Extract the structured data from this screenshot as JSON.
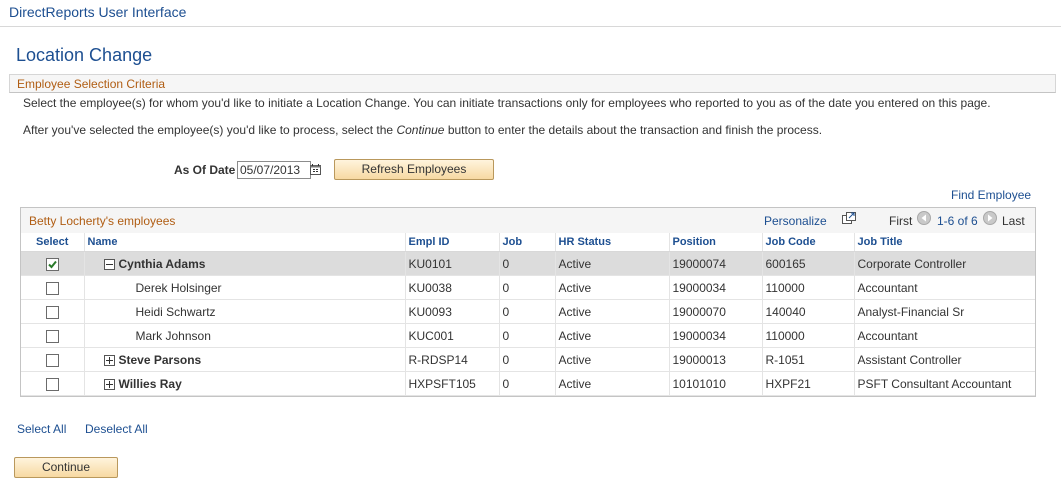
{
  "app": {
    "title": "DirectReports User Interface"
  },
  "page": {
    "title": "Location Change"
  },
  "section": {
    "title": "Employee Selection Criteria"
  },
  "instructions": {
    "line1": "Select the employee(s) for whom you'd like to initiate a Location Change. You can initiate transactions only for employees who reported to you as of the date you entered on this page.",
    "line2_before": "After you've selected the employee(s) you'd like to process, select the ",
    "line2_emph": "Continue",
    "line2_after": " button to enter the details about the transaction and finish the process."
  },
  "as_of": {
    "label": "As Of Date",
    "value": "05/07/2013",
    "icon": "calendar-icon"
  },
  "buttons": {
    "refresh": "Refresh Employees",
    "continue": "Continue"
  },
  "find_employee": "Find Employee",
  "grid": {
    "caption": "Betty Locherty's employees",
    "personalize": "Personalize",
    "zoom_icon": "zoom-icon",
    "nav": {
      "first": "First",
      "range": "1-6 of 6",
      "last": "Last"
    },
    "columns": [
      "Select",
      "Name",
      "Empl ID",
      "Job",
      "HR Status",
      "Position",
      "Job Code",
      "Job Title"
    ],
    "rows": [
      {
        "checked": true,
        "tree": "minus",
        "level": 1,
        "bold": true,
        "name": "Cynthia Adams",
        "empl_id": "KU0101",
        "job": "0",
        "hr_status": "Active",
        "position": "19000074",
        "job_code": "600165",
        "job_title": "Corporate Controller"
      },
      {
        "checked": false,
        "tree": "",
        "level": 2,
        "bold": false,
        "name": "Derek Holsinger",
        "empl_id": "KU0038",
        "job": "0",
        "hr_status": "Active",
        "position": "19000034",
        "job_code": "110000",
        "job_title": "Accountant"
      },
      {
        "checked": false,
        "tree": "",
        "level": 2,
        "bold": false,
        "name": "Heidi Schwartz",
        "empl_id": "KU0093",
        "job": "0",
        "hr_status": "Active",
        "position": "19000070",
        "job_code": "140040",
        "job_title": "Analyst-Financial Sr"
      },
      {
        "checked": false,
        "tree": "",
        "level": 2,
        "bold": false,
        "name": "Mark Johnson",
        "empl_id": "KUC001",
        "job": "0",
        "hr_status": "Active",
        "position": "19000034",
        "job_code": "110000",
        "job_title": "Accountant"
      },
      {
        "checked": false,
        "tree": "plus",
        "level": 1,
        "bold": true,
        "name": "Steve Parsons",
        "empl_id": "R-RDSP14",
        "job": "0",
        "hr_status": "Active",
        "position": "19000013",
        "job_code": "R-1051",
        "job_title": "Assistant Controller"
      },
      {
        "checked": false,
        "tree": "plus",
        "level": 1,
        "bold": true,
        "name": "Willies Ray",
        "empl_id": "HXPSFT105",
        "job": "0",
        "hr_status": "Active",
        "position": "10101010",
        "job_code": "HXPF21",
        "job_title": "PSFT Consultant Accountant"
      }
    ]
  },
  "links": {
    "select_all": "Select All",
    "deselect_all": "Deselect All"
  }
}
